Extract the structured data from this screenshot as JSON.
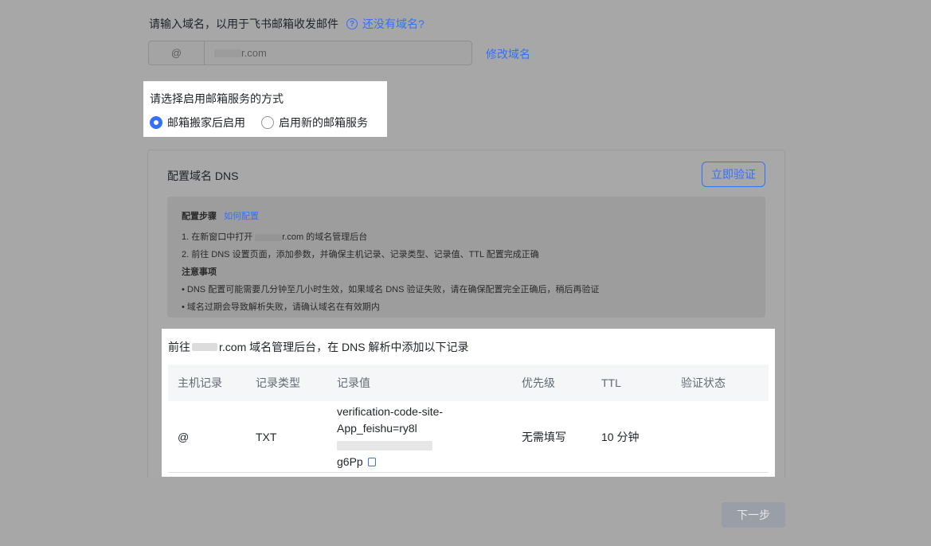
{
  "domain_section": {
    "label": "请输入域名，以用于飞书邮箱收发邮件",
    "help_link": "还没有域名?",
    "prefix": "@",
    "domain_suffix": "r.com",
    "modify_link": "修改域名"
  },
  "method_section": {
    "title": "请选择启用邮箱服务的方式",
    "options": [
      {
        "label": "邮箱搬家后启用",
        "checked": true
      },
      {
        "label": "启用新的邮箱服务",
        "checked": false
      }
    ]
  },
  "dns_section": {
    "title": "配置域名 DNS",
    "verify_button": "立即验证",
    "steps_heading": "配置步骤",
    "how_link": "如何配置",
    "step1_prefix": "1. 在新窗口中打开",
    "step1_suffix": "r.com 的域名管理后台",
    "step2": "2. 前往 DNS 设置页面，添加参数，并确保主机记录、记录类型、记录值、TTL 配置完成正确",
    "notes_heading": "注意事项",
    "note1": "• DNS 配置可能需要几分钟至几小时生效，如果域名 DNS 验证失败，请在确保配置完全正确后，稍后再验证",
    "note2": "• 域名过期会导致解析失败，请确认域名在有效期内"
  },
  "records": {
    "intro_prefix": "前往",
    "intro_suffix": "r.com 域名管理后台，在 DNS 解析中添加以下记录",
    "columns": [
      "主机记录",
      "记录类型",
      "记录值",
      "优先级",
      "TTL",
      "验证状态"
    ],
    "row": {
      "host": "@",
      "type": "TXT",
      "value_line1": "verification-code-site-",
      "value_line2": "App_feishu=ry8l",
      "value_line3": "g6Pp",
      "priority": "无需填写",
      "ttl": "10 分钟",
      "status": ""
    }
  },
  "footer": {
    "next_button": "下一步"
  },
  "colors": {
    "accent": "#3370ff",
    "overlay_bg": "#a7a7a7"
  }
}
